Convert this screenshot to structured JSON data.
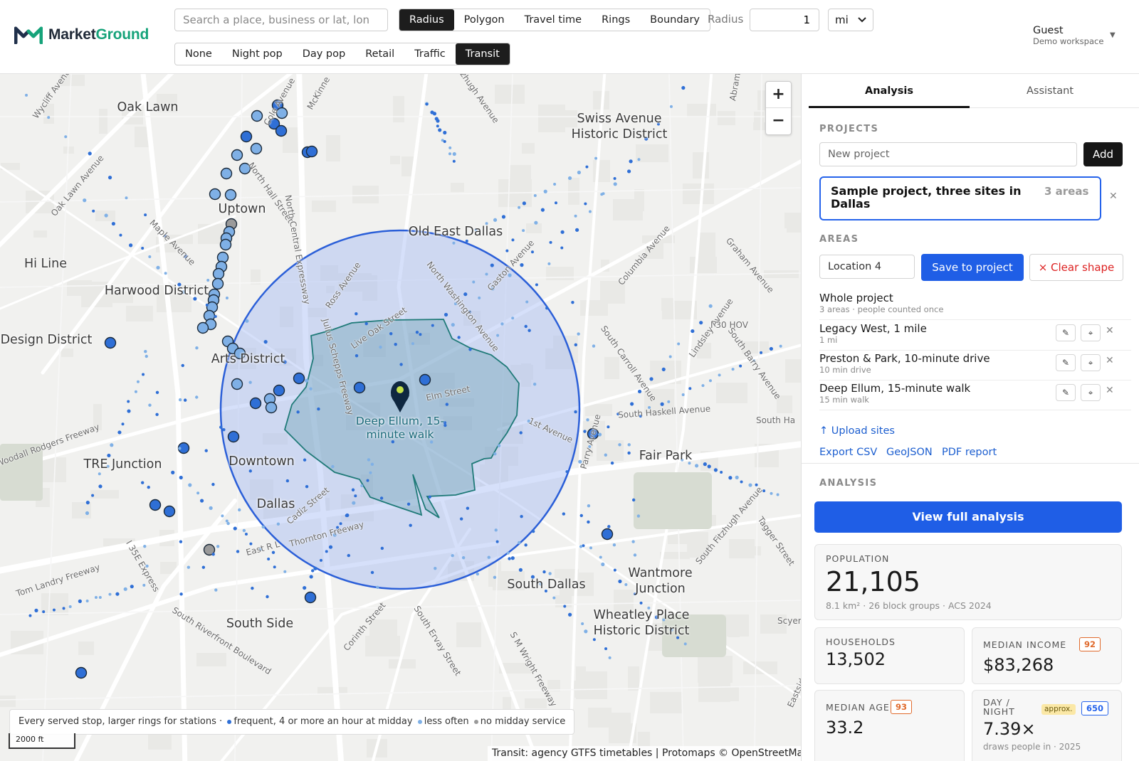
{
  "header": {
    "logo": {
      "part1": "Market",
      "part2": "Ground"
    },
    "search_placeholder": "Search a place, business or lat, lon",
    "modes": [
      "Radius",
      "Polygon",
      "Travel time",
      "Rings",
      "Boundary"
    ],
    "active_mode": "Radius",
    "layers": [
      "None",
      "Night pop",
      "Day pop",
      "Retail",
      "Traffic",
      "Transit"
    ],
    "active_layer": "Transit",
    "radius_label": "Radius",
    "radius_value": "1",
    "unit": "mi",
    "user": {
      "name": "Guest",
      "workspace": "Demo workspace"
    }
  },
  "map": {
    "neighborhoods": [
      "Oak Lawn",
      "Swiss Avenue\nHistoric District",
      "Uptown",
      "Old East Dallas",
      "Hi Line",
      "Harwood District",
      "Design District",
      "Arts District",
      "Deep Ellum, 15-\nminute walk",
      "TRE Junction",
      "Downtown",
      "Fair Park",
      "Dallas",
      "South Dallas",
      "Wantmore\nJunction",
      "Wheatley Place\nHistoric District",
      "South Side"
    ],
    "streets": [
      "Wycliff Avenue",
      "Cole Avenue",
      "McKinne",
      "Fitzhugh Avenue",
      "Abrams",
      "Oak Lawn Avenue",
      "North Hall Street",
      "North Central Expressway",
      "Maple Avenue",
      "Ross Avenue",
      "North Washington Avenue",
      "Live Oak Street",
      "Gaston Avenue",
      "Columbia Avenue",
      "Graham Avenue",
      "Julius Schepps Freeway",
      "Elm Street",
      "1st Avenue",
      "South Carroll Avenue",
      "Lindsley Avenue",
      "I 30 HOV",
      "South Barry Avenue",
      "South Haskell Avenue",
      "South Ha",
      "Parry Avenue",
      "Woodall Rodgers Freeway",
      "Cadiz Street",
      "Thornton Freeway",
      "East R L",
      "I 35E Express",
      "Tom Landry Freeway",
      "South Riverfront Boulevard",
      "Corinth Street",
      "South Ervay Street",
      "S M Wright Freeway",
      "South Fitzhugh Avenue",
      "Scyene",
      "Eastside",
      "Tagger Street"
    ],
    "zoom_in": "+",
    "zoom_out": "−",
    "legend": {
      "intro": "Every served stop, larger rings for stations ·",
      "frequent": "frequent, 4 or more an hour at midday",
      "less": "less often",
      "none": "no midday service"
    },
    "legend_colors": {
      "frequent": "#2f6fd6",
      "less": "#7fb0e6",
      "none": "#9a9a9a"
    },
    "scale": "2000 ft",
    "attribution": "Transit: agency GTFS timetables | Protomaps © OpenStreetMap"
  },
  "panel": {
    "tabs": [
      "Analysis",
      "Assistant"
    ],
    "active_tab": "Analysis",
    "projects_heading": "PROJECTS",
    "new_project_placeholder": "New project",
    "add_label": "Add",
    "project": {
      "name": "Sample project, three sites in Dallas",
      "count": "3 areas"
    },
    "areas_heading": "AREAS",
    "area_name_value": "Location 4",
    "save_label": "Save to project",
    "clear_label": "× Clear shape",
    "whole": {
      "name": "Whole project",
      "sub": "3 areas · people counted once"
    },
    "areas": [
      {
        "name": "Legacy West, 1 mile",
        "sub": "1 mi"
      },
      {
        "name": "Preston & Park, 10-minute drive",
        "sub": "10 min drive"
      },
      {
        "name": "Deep Ellum, 15-minute walk",
        "sub": "15 min walk"
      }
    ],
    "upload_label": "↑ Upload sites",
    "export_links": [
      "Export CSV",
      "GeoJSON",
      "PDF report"
    ],
    "analysis_heading": "ANALYSIS",
    "view_label": "View full analysis",
    "stats": {
      "population": {
        "label": "POPULATION",
        "value": "21,105",
        "sub": "8.1 km² · 26 block groups · ACS 2024"
      },
      "households": {
        "label": "HOUSEHOLDS",
        "value": "13,502"
      },
      "income": {
        "label": "MEDIAN INCOME",
        "value": "$83,268",
        "badge": "92"
      },
      "age": {
        "label": "MEDIAN AGE",
        "value": "33.2",
        "badge": "93"
      },
      "daynight": {
        "label": "DAY /\nNIGHT",
        "value": "7.39×",
        "approx": "approx.",
        "badge": "650",
        "sub": "draws people in · 2025"
      }
    }
  },
  "colors": {
    "accent": "#1f5ee6",
    "brand_green": "#16a37a",
    "brand_dark": "#1f2937",
    "circle": "#2b5fd8",
    "walkshed": "#1f7a78",
    "badge_orange": "#e06a2c",
    "badge_blue": "#2563eb"
  }
}
